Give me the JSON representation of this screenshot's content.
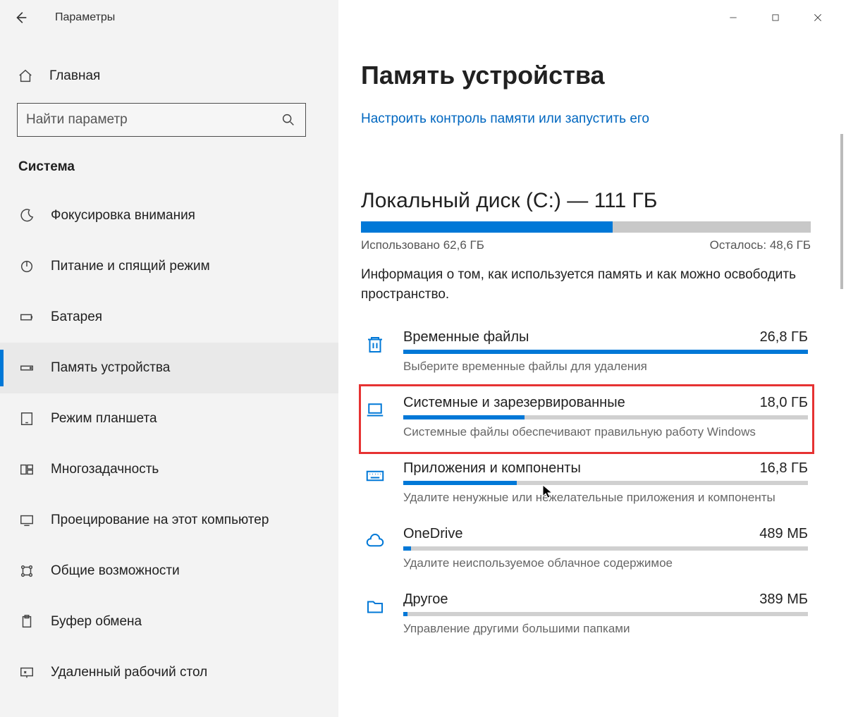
{
  "window": {
    "title": "Параметры"
  },
  "sidebar": {
    "home": "Главная",
    "search_placeholder": "Найти параметр",
    "section": "Система",
    "items": [
      {
        "label": "Фокусировка внимания"
      },
      {
        "label": "Питание и спящий режим"
      },
      {
        "label": "Батарея"
      },
      {
        "label": "Память устройства"
      },
      {
        "label": "Режим планшета"
      },
      {
        "label": "Многозадачность"
      },
      {
        "label": "Проецирование на этот компьютер"
      },
      {
        "label": "Общие возможности"
      },
      {
        "label": "Буфер обмена"
      },
      {
        "label": "Удаленный рабочий стол"
      }
    ]
  },
  "main": {
    "heading": "Память устройства",
    "link": "Настроить контроль памяти или запустить его",
    "disk_heading": "Локальный диск (C:) — 111 ГБ",
    "used_label": "Использовано 62,6 ГБ",
    "remaining_label": "Осталось: 48,6 ГБ",
    "used_percent": 56,
    "description": "Информация о том, как используется память и как можно освободить пространство.",
    "categories": [
      {
        "title": "Временные файлы",
        "size": "26,8 ГБ",
        "sub": "Выберите временные файлы для удаления",
        "percent": 100
      },
      {
        "title": "Системные и зарезервированные",
        "size": "18,0 ГБ",
        "sub": "Системные файлы обеспечивают правильную работу Windows",
        "percent": 30
      },
      {
        "title": "Приложения и компоненты",
        "size": "16,8 ГБ",
        "sub": "Удалите ненужные или нежелательные приложения и компоненты",
        "percent": 28
      },
      {
        "title": "OneDrive",
        "size": "489 МБ",
        "sub": "Удалите неиспользуемое облачное содержимое",
        "percent": 2
      },
      {
        "title": "Другое",
        "size": "389 МБ",
        "sub": "Управление другими большими папками",
        "percent": 1
      }
    ]
  }
}
